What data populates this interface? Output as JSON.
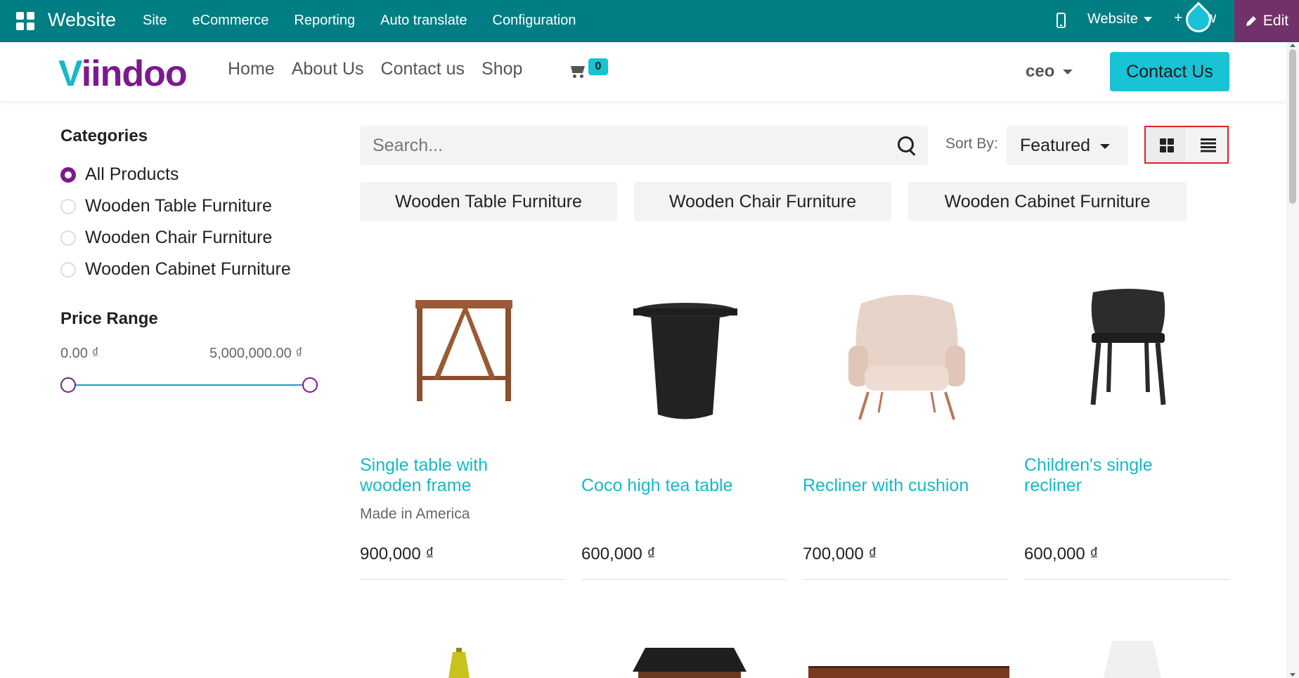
{
  "admin_bar": {
    "app_name": "Website",
    "menu": [
      "Site",
      "eCommerce",
      "Reporting",
      "Auto translate",
      "Configuration"
    ],
    "website_selector": "Website",
    "new_label": "+ New",
    "edit_label": "Edit",
    "colors": {
      "bar": "#017e84",
      "edit": "#71316b"
    }
  },
  "site_header": {
    "logo_v": "V",
    "logo_rest": "iindoo",
    "nav": [
      "Home",
      "About Us",
      "Contact us",
      "Shop"
    ],
    "cart_count": "0",
    "user": "ceo",
    "contact_button": "Contact Us",
    "colors": {
      "accent": "#17c3d4",
      "brand": "#7a1a8c"
    }
  },
  "sidebar": {
    "categories_title": "Categories",
    "categories": [
      "All Products",
      "Wooden Table Furniture",
      "Wooden Chair Furniture",
      "Wooden Cabinet Furniture"
    ],
    "selected_category": "All Products",
    "price_title": "Price Range",
    "price_min": "0.00 ₫",
    "price_max": "5,000,000.00 ₫"
  },
  "toolbar": {
    "search_placeholder": "Search...",
    "sort_label": "Sort By:",
    "sort_value": "Featured",
    "view_modes": [
      "grid-icon",
      "list-icon"
    ],
    "active_view": "grid"
  },
  "category_pills": [
    "Wooden Table Furniture",
    "Wooden Chair Furniture",
    "Wooden Cabinet Furniture"
  ],
  "products": [
    {
      "name": "Single table with wooden frame",
      "description": "Made in America",
      "price": "900,000 ₫"
    },
    {
      "name": "Coco high tea table",
      "description": "",
      "price": "600,000 ₫"
    },
    {
      "name": "Recliner with cushion",
      "description": "",
      "price": "700,000 ₫"
    },
    {
      "name": "Children's single recliner",
      "description": "",
      "price": "600,000 ₫"
    }
  ]
}
